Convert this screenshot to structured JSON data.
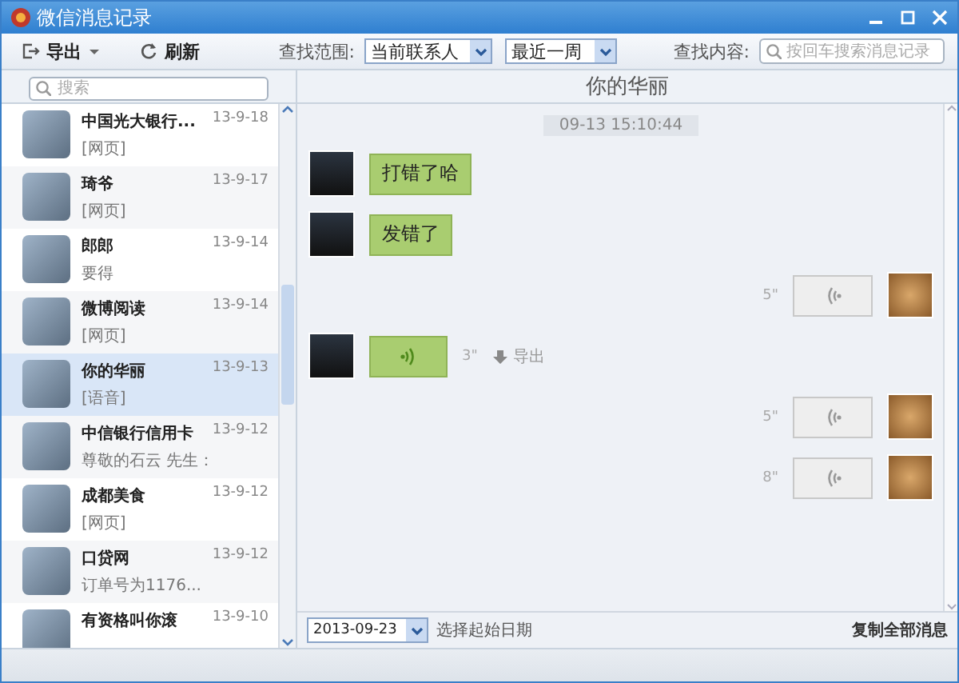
{
  "window": {
    "title": "微信消息记录"
  },
  "toolbar": {
    "export": "导出",
    "refresh": "刷新",
    "scope_label": "查找范围:",
    "scope_value": "当前联系人",
    "period_value": "最近一周",
    "find_label": "查找内容:",
    "find_placeholder": "按回车搜索消息记录"
  },
  "sidebar": {
    "search_placeholder": "搜索",
    "contacts": [
      {
        "name": "中国光大银行...",
        "preview": "[网页]",
        "date": "13-9-18",
        "selected": false
      },
      {
        "name": "琦爷",
        "preview": "[网页]",
        "date": "13-9-17",
        "selected": false
      },
      {
        "name": "郎郎",
        "preview": "要得",
        "date": "13-9-14",
        "selected": false
      },
      {
        "name": "微博阅读",
        "preview": "[网页]",
        "date": "13-9-14",
        "selected": false
      },
      {
        "name": "你的华丽",
        "preview": "[语音]",
        "date": "13-9-13",
        "selected": true
      },
      {
        "name": "中信银行信用卡",
        "preview": "尊敬的石云 先生：",
        "date": "13-9-12",
        "selected": false
      },
      {
        "name": "成都美食",
        "preview": "[网页]",
        "date": "13-9-12",
        "selected": false
      },
      {
        "name": "口贷网",
        "preview": "订单号为1176...",
        "date": "13-9-12",
        "selected": false
      },
      {
        "name": "有资格叫你滚",
        "date": "13-9-10",
        "selected": false
      }
    ]
  },
  "chat": {
    "title": "你的华丽",
    "messages": [
      {
        "kind": "time",
        "text": "09-13 15:10:44"
      },
      {
        "kind": "text",
        "outgoing": false,
        "text": "打错了哈"
      },
      {
        "kind": "text",
        "outgoing": false,
        "text": "发错了"
      },
      {
        "kind": "voice",
        "outgoing": true,
        "duration": "5\""
      },
      {
        "kind": "voice",
        "outgoing": false,
        "duration": "3\"",
        "export": "导出"
      },
      {
        "kind": "voice",
        "outgoing": true,
        "duration": "5\""
      },
      {
        "kind": "voice",
        "outgoing": true,
        "duration": "8\""
      }
    ],
    "start_date": "2013-09-23",
    "start_date_label": "选择起始日期",
    "copy_all": "复制全部消息"
  }
}
